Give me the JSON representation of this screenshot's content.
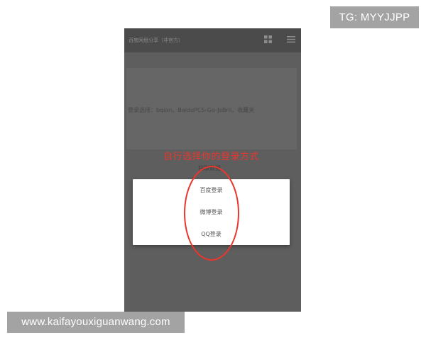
{
  "phone": {
    "app_title": "百度网盘分享（非官方）",
    "card_text": "登录选择：bqian、BaiduPCS-Go-JsBril，收藏夹",
    "behind_text": "获取数据"
  },
  "annotation": "自行选择你的登录方式",
  "dialog": {
    "items": [
      {
        "label": "百度登录"
      },
      {
        "label": "微博登录"
      },
      {
        "label": "QQ登录"
      }
    ]
  },
  "watermarks": {
    "top_right": "TG: MYYJJPP",
    "bottom_left": "www.kaifayouxiguanwang.com"
  },
  "icons": {
    "header_left": "grid-icon",
    "header_right": "menu-icon"
  },
  "colors": {
    "annotation": "#e8372e",
    "overlay": "#5e5e5e",
    "header": "#4b4b4b",
    "watermark_bg": "#a3a3a3"
  }
}
